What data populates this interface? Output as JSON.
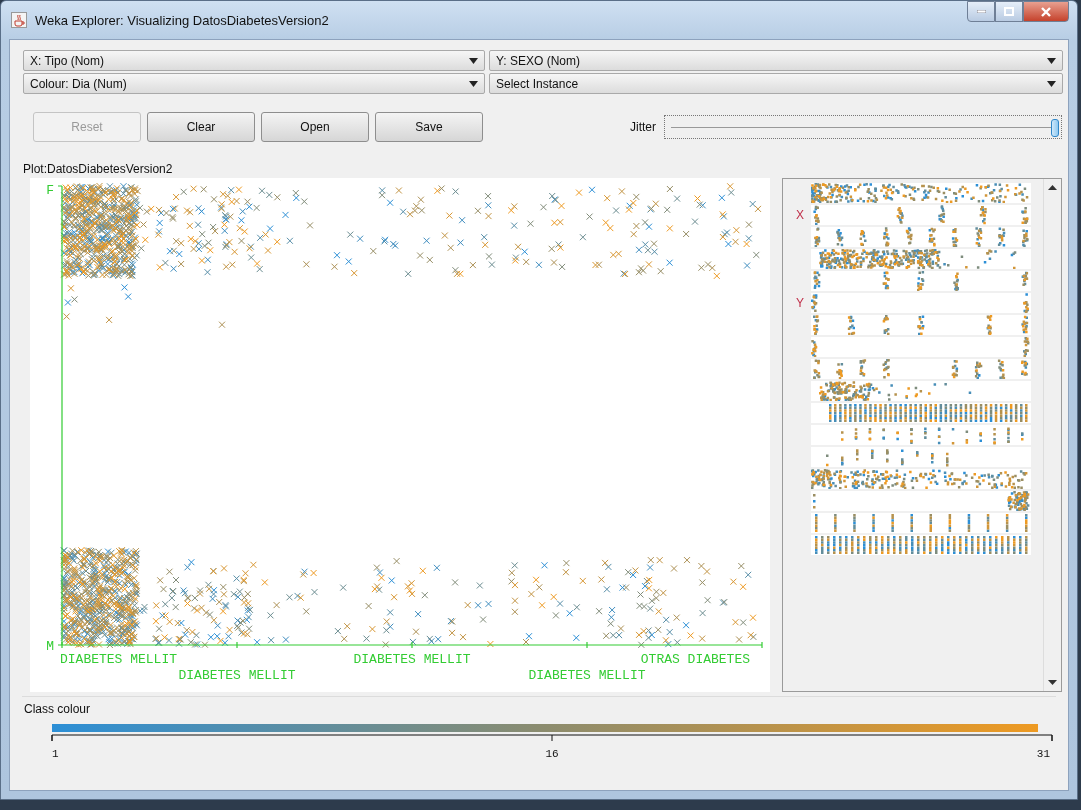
{
  "window": {
    "title": "Weka Explorer: Visualizing DatosDiabetesVersion2"
  },
  "selectors": [
    {
      "label": "X: Tipo (Nom)"
    },
    {
      "label": "Y: SEXO (Nom)"
    },
    {
      "label": "Colour: Dia (Num)"
    },
    {
      "label": "Select Instance"
    }
  ],
  "buttons": [
    {
      "label": "Reset",
      "disabled": true
    },
    {
      "label": "Clear",
      "disabled": false
    },
    {
      "label": "Open",
      "disabled": false
    },
    {
      "label": "Save",
      "disabled": false
    }
  ],
  "jitter": {
    "label": "Jitter",
    "level": 1.0
  },
  "plot": {
    "title": "Plot:DatosDiabetesVersion2",
    "y_labels": [
      "F",
      "M"
    ],
    "x_labels": [
      "DIABETES MELLIT",
      "DIABETES MELLIT",
      "DIABETES MELLIT",
      "DIABETES MELLIT",
      "OTRAS DIABETES"
    ]
  },
  "attribute_strips": [
    {
      "kind": "scatter"
    },
    {
      "kind": "columns",
      "marker": "X"
    },
    {
      "kind": "columns"
    },
    {
      "kind": "block"
    },
    {
      "kind": "columns"
    },
    {
      "kind": "edges",
      "marker": "Y"
    },
    {
      "kind": "columns"
    },
    {
      "kind": "edges"
    },
    {
      "kind": "columns"
    },
    {
      "kind": "block"
    },
    {
      "kind": "bars"
    },
    {
      "kind": "sparse"
    },
    {
      "kind": "sparse"
    },
    {
      "kind": "scatter"
    },
    {
      "kind": "corner"
    },
    {
      "kind": "bars"
    },
    {
      "kind": "bars"
    }
  ],
  "class_colour": {
    "title": "Class colour",
    "ticks": [
      "1",
      "16",
      "31"
    ]
  }
}
